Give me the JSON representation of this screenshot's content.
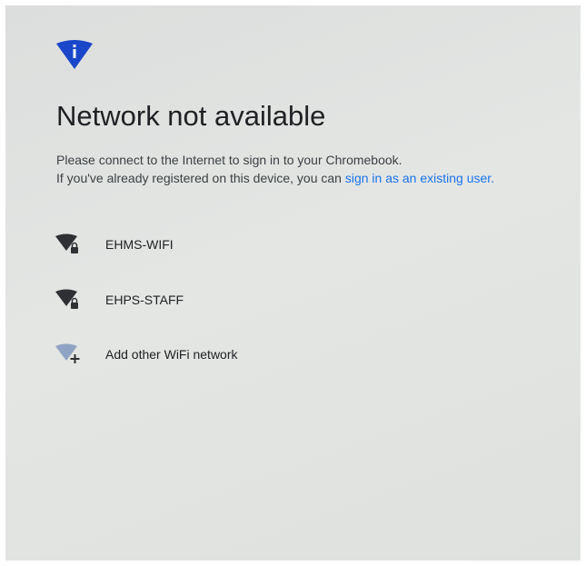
{
  "page": {
    "title": "Network not available",
    "description_line1": "Please connect to the Internet to sign in to your Chromebook.",
    "description_line2_prefix": "If you've already registered on this device, you can ",
    "existing_user_link": "sign in as an existing user.",
    "header_icon": "wifi-info-icon"
  },
  "networks": [
    {
      "ssid": "EHMS-WIFI",
      "icon": "wifi-locked-icon"
    },
    {
      "ssid": "EHPS-STAFF",
      "icon": "wifi-locked-icon"
    }
  ],
  "add_network": {
    "label": "Add other WiFi network",
    "icon": "wifi-add-icon"
  },
  "colors": {
    "accent": "#1a73e8",
    "header_icon": "#1a47c9",
    "text": "#202124",
    "wifi_icon": "#2e3033",
    "wifi_add_icon": "#8fa3c4"
  }
}
